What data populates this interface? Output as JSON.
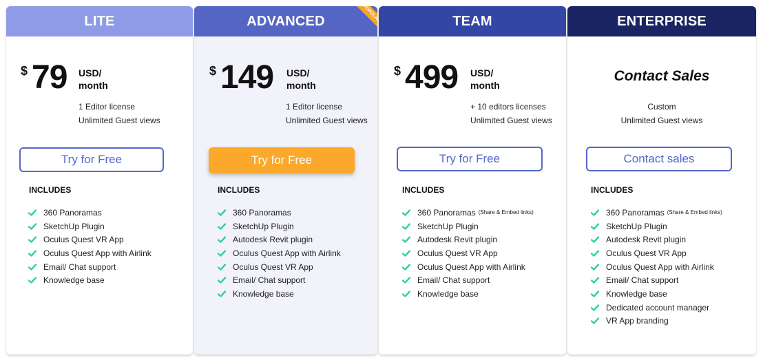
{
  "colors": {
    "lite_header": "#8f9be6",
    "advanced_header": "#5565c4",
    "team_header": "#3346a6",
    "enterprise_header": "#1b2462",
    "accent": "#5566cc",
    "cta_orange": "#fca82a",
    "check_green": "#2fd29a"
  },
  "includes_label": "INCLUDES",
  "plans": [
    {
      "name": "LITE",
      "currency": "$",
      "price": "79",
      "unit_line1": "USD/",
      "unit_line2": "month",
      "desc": [
        "1 Editor license",
        "Unlimited Guest views"
      ],
      "button": "Try for Free",
      "features": [
        {
          "text": "360 Panoramas",
          "note": ""
        },
        {
          "text": "SketchUp Plugin",
          "note": ""
        },
        {
          "text": "Oculus Quest VR App",
          "note": ""
        },
        {
          "text": "Oculus Quest App with Airlink",
          "note": ""
        },
        {
          "text": "Email/ Chat support",
          "note": ""
        },
        {
          "text": "Knowledge base",
          "note": ""
        }
      ]
    },
    {
      "name": "ADVANCED",
      "badge": "POPULAR",
      "currency": "$",
      "price": "149",
      "unit_line1": "USD/",
      "unit_line2": "month",
      "desc": [
        "1 Editor license",
        "Unlimited Guest views"
      ],
      "button": "Try for Free",
      "features": [
        {
          "text": "360 Panoramas",
          "note": ""
        },
        {
          "text": "SketchUp Plugin",
          "note": ""
        },
        {
          "text": "Autodesk Revit plugin",
          "note": ""
        },
        {
          "text": "Oculus Quest App with Airlink",
          "note": ""
        },
        {
          "text": "Oculus Quest VR App",
          "note": ""
        },
        {
          "text": "Email/ Chat support",
          "note": ""
        },
        {
          "text": "Knowledge base",
          "note": ""
        }
      ]
    },
    {
      "name": "TEAM",
      "currency": "$",
      "price": "499",
      "unit_line1": "USD/",
      "unit_line2": "month",
      "desc": [
        "+ 10 editors licenses",
        "Unlimited Guest views"
      ],
      "button": "Try for Free",
      "features": [
        {
          "text": "360 Panoramas",
          "note": "(Share & Embed links)"
        },
        {
          "text": "SketchUp Plugin",
          "note": ""
        },
        {
          "text": "Autodesk Revit plugin",
          "note": ""
        },
        {
          "text": "Oculus Quest VR App",
          "note": ""
        },
        {
          "text": "Oculus Quest App with Airlink",
          "note": ""
        },
        {
          "text": "Email/ Chat support",
          "note": ""
        },
        {
          "text": "Knowledge base",
          "note": ""
        }
      ]
    },
    {
      "name": "ENTERPRISE",
      "contact_title": "Contact Sales",
      "desc": [
        "Custom",
        "Unlimited Guest views"
      ],
      "button": "Contact sales",
      "features": [
        {
          "text": "360 Panoramas",
          "note": "(Share & Embed links)"
        },
        {
          "text": "SketchUp Plugin",
          "note": ""
        },
        {
          "text": "Autodesk Revit plugin",
          "note": ""
        },
        {
          "text": "Oculus Quest VR App",
          "note": ""
        },
        {
          "text": "Oculus Quest App with Airlink",
          "note": ""
        },
        {
          "text": "Email/ Chat support",
          "note": ""
        },
        {
          "text": "Knowledge base",
          "note": ""
        },
        {
          "text": "Dedicated account manager",
          "note": ""
        },
        {
          "text": "VR App branding",
          "note": ""
        }
      ]
    }
  ]
}
